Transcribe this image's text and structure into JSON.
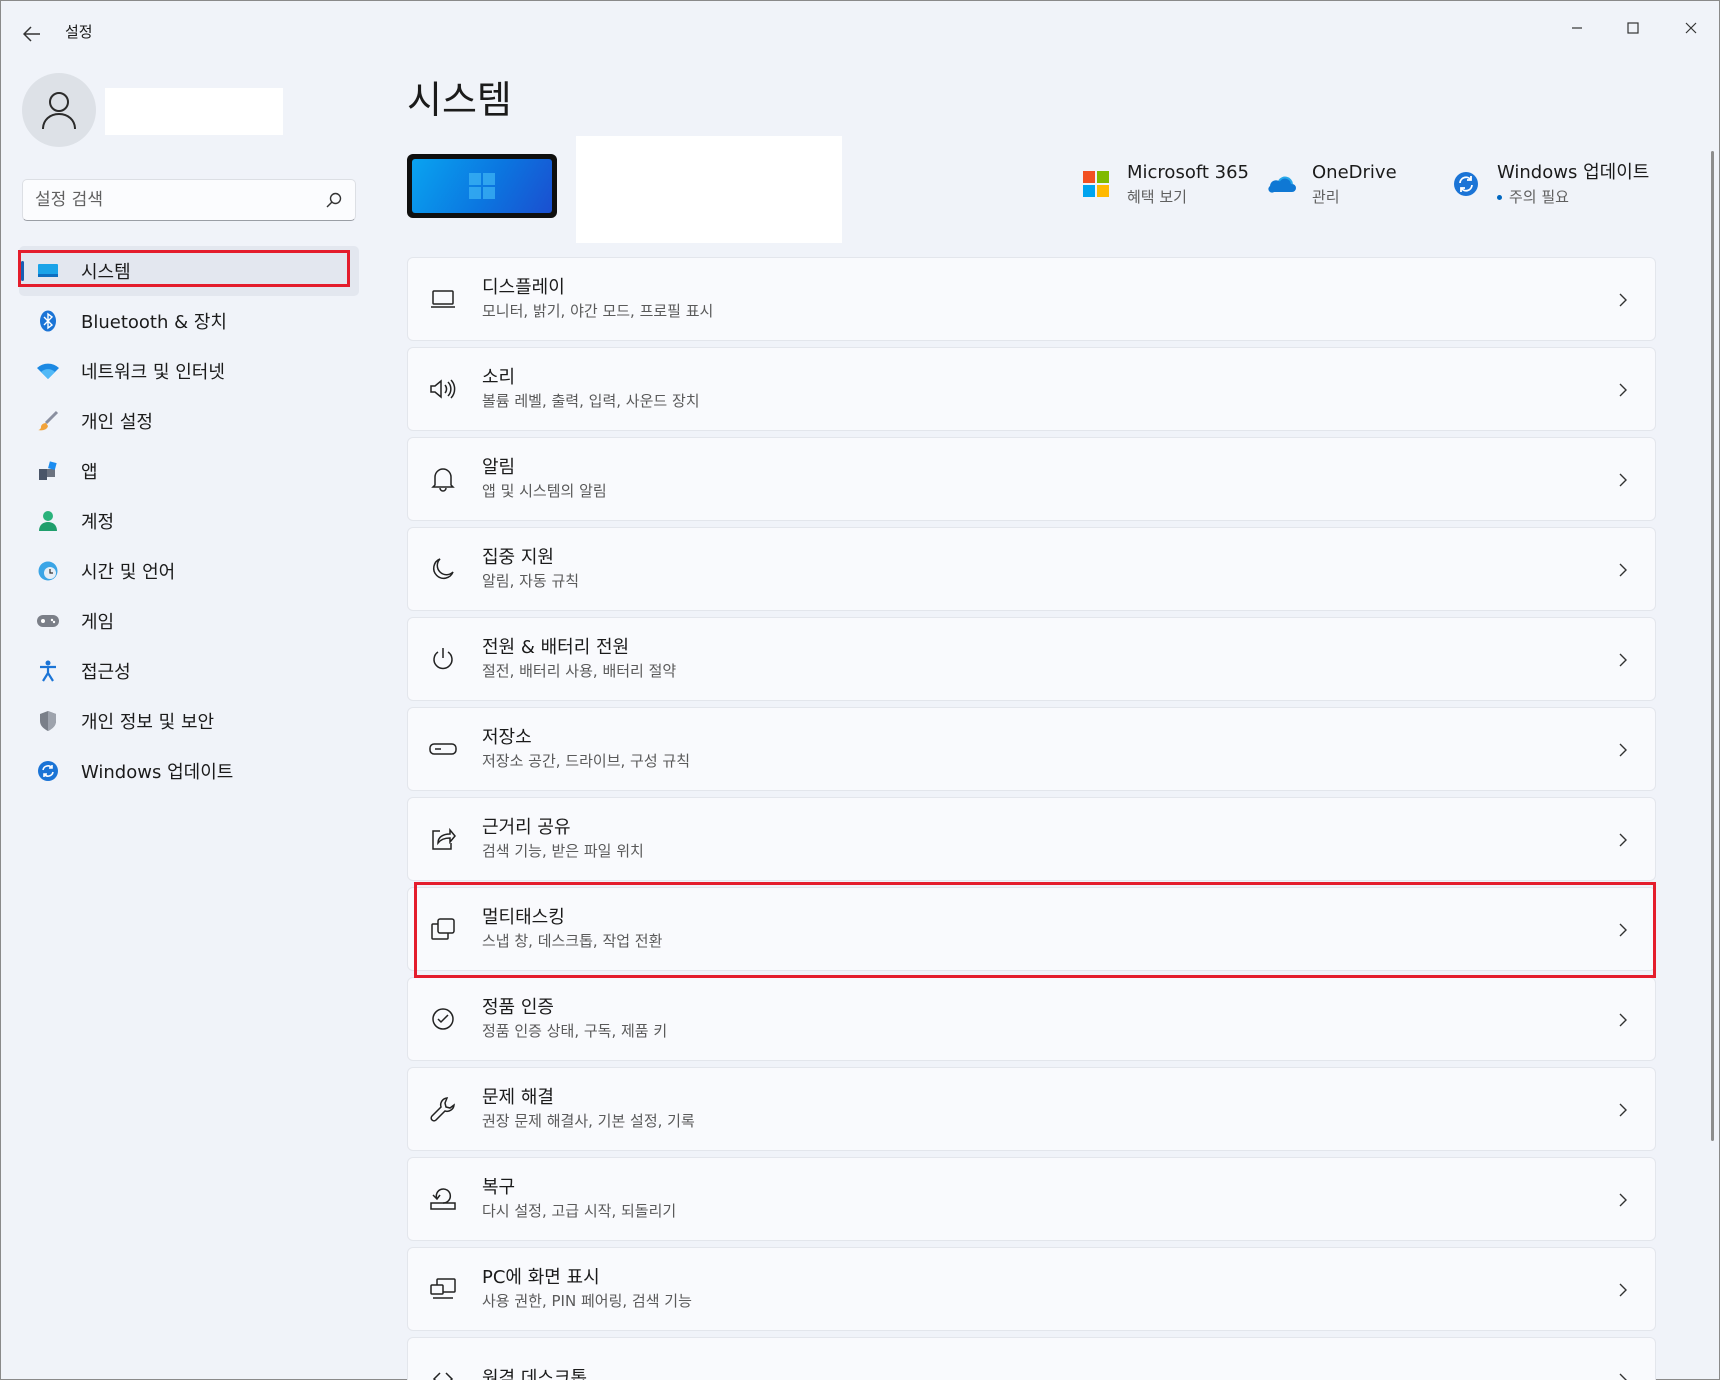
{
  "app": {
    "title": "설정"
  },
  "sidebar": {
    "search_placeholder": "설정 검색",
    "items": [
      {
        "label": "시스템",
        "icon": "system-icon",
        "active": true
      },
      {
        "label": "Bluetooth & 장치",
        "icon": "bluetooth-icon"
      },
      {
        "label": "네트워크 및 인터넷",
        "icon": "network-icon"
      },
      {
        "label": "개인 설정",
        "icon": "brush-icon"
      },
      {
        "label": "앱",
        "icon": "apps-icon"
      },
      {
        "label": "계정",
        "icon": "account-icon"
      },
      {
        "label": "시간 및 언어",
        "icon": "time-language-icon"
      },
      {
        "label": "게임",
        "icon": "gaming-icon"
      },
      {
        "label": "접근성",
        "icon": "accessibility-icon"
      },
      {
        "label": "개인 정보 및 보안",
        "icon": "shield-icon"
      },
      {
        "label": "Windows 업데이트",
        "icon": "update-icon"
      }
    ]
  },
  "main": {
    "title": "시스템",
    "quick_links": [
      {
        "title": "Microsoft 365",
        "subtitle": "혜택 보기",
        "icon": "microsoft-logo-icon"
      },
      {
        "title": "OneDrive",
        "subtitle": "관리",
        "icon": "onedrive-icon"
      },
      {
        "title": "Windows 업데이트",
        "subtitle": "주의 필요",
        "icon": "update-icon"
      }
    ],
    "cards": [
      {
        "title": "디스플레이",
        "subtitle": "모니터, 밝기, 야간 모드, 프로필 표시",
        "icon": "display-icon"
      },
      {
        "title": "소리",
        "subtitle": "볼륨 레벨, 출력, 입력, 사운드 장치",
        "icon": "speaker-icon"
      },
      {
        "title": "알림",
        "subtitle": "앱 및 시스템의 알림",
        "icon": "bell-icon"
      },
      {
        "title": "집중 지원",
        "subtitle": "알림, 자동 규칙",
        "icon": "moon-icon"
      },
      {
        "title": "전원 & 배터리 전원",
        "subtitle": "절전, 배터리 사용, 배터리 절약",
        "icon": "power-icon"
      },
      {
        "title": "저장소",
        "subtitle": "저장소 공간, 드라이브, 구성 규칙",
        "icon": "storage-icon"
      },
      {
        "title": "근거리 공유",
        "subtitle": "검색 기능, 받은 파일 위치",
        "icon": "share-icon"
      },
      {
        "title": "멀티태스킹",
        "subtitle": "스냅 창, 데스크톱, 작업 전환",
        "icon": "multitasking-icon"
      },
      {
        "title": "정품 인증",
        "subtitle": "정품 인증 상태, 구독, 제품 키",
        "icon": "check-circle-icon"
      },
      {
        "title": "문제 해결",
        "subtitle": "권장 문제 해결사, 기본 설정, 기록",
        "icon": "wrench-icon"
      },
      {
        "title": "복구",
        "subtitle": "다시 설정, 고급 시작, 되돌리기",
        "icon": "recovery-icon"
      },
      {
        "title": "PC에 화면 표시",
        "subtitle": "사용 권한, PIN 페어링, 검색 기능",
        "icon": "project-icon"
      },
      {
        "title": "원격 데스크톱",
        "subtitle": "",
        "icon": "remote-desktop-icon"
      }
    ]
  },
  "colors": {
    "accent": "#1a5fb4",
    "highlight": "#e41d2c",
    "background": "#f0f3f9"
  }
}
